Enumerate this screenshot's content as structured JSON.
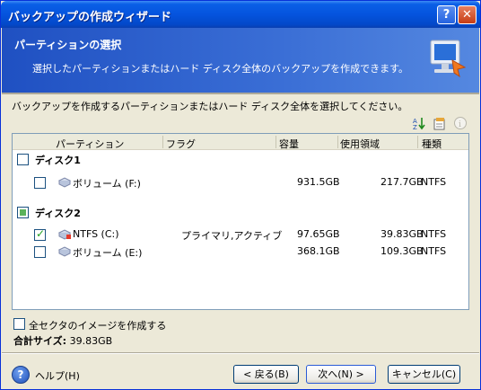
{
  "window": {
    "title": "バックアップの作成ウィザード"
  },
  "header": {
    "title": "パーティションの選択",
    "description": "選択したパーティションまたはハード ディスク全体のバックアップを作成できます。"
  },
  "instruction": "バックアップを作成するパーティションまたはハード ディスク全体を選択してください。",
  "toolbar": {
    "icons": [
      "sort-icon",
      "properties-icon",
      "info-icon"
    ]
  },
  "columns": [
    "パーティション",
    "フラグ",
    "容量",
    "使用領域",
    "種類"
  ],
  "disks": [
    {
      "label": "ディスク1",
      "state": "unchecked",
      "partitions": [
        {
          "name": "ボリューム (F:)",
          "flags": "",
          "capacity": "931.5GB",
          "used": "217.7GB",
          "type": "NTFS",
          "checked": false
        }
      ]
    },
    {
      "label": "ディスク2",
      "state": "partial",
      "partitions": [
        {
          "name": "NTFS (C:)",
          "flags": "プライマリ,アクティブ",
          "capacity": "97.65GB",
          "used": "39.83GB",
          "type": "NTFS",
          "checked": true
        },
        {
          "name": "ボリューム (E:)",
          "flags": "",
          "capacity": "368.1GB",
          "used": "109.3GB",
          "type": "NTFS",
          "checked": false
        }
      ]
    }
  ],
  "options": {
    "sector_image_label": "全セクタのイメージを作成する",
    "sector_image_checked": false
  },
  "total": {
    "label": "合計サイズ:",
    "value": "39.83GB"
  },
  "buttons": {
    "help": "ヘルプ(H)",
    "back": "< 戻る(B)",
    "next": "次へ(N) >",
    "cancel": "キャンセル(C)"
  },
  "colors": {
    "titlebar": "#0554de",
    "header": "#1f50c2",
    "dialog_bg": "#ece9d8",
    "check_green": "#21a121"
  }
}
